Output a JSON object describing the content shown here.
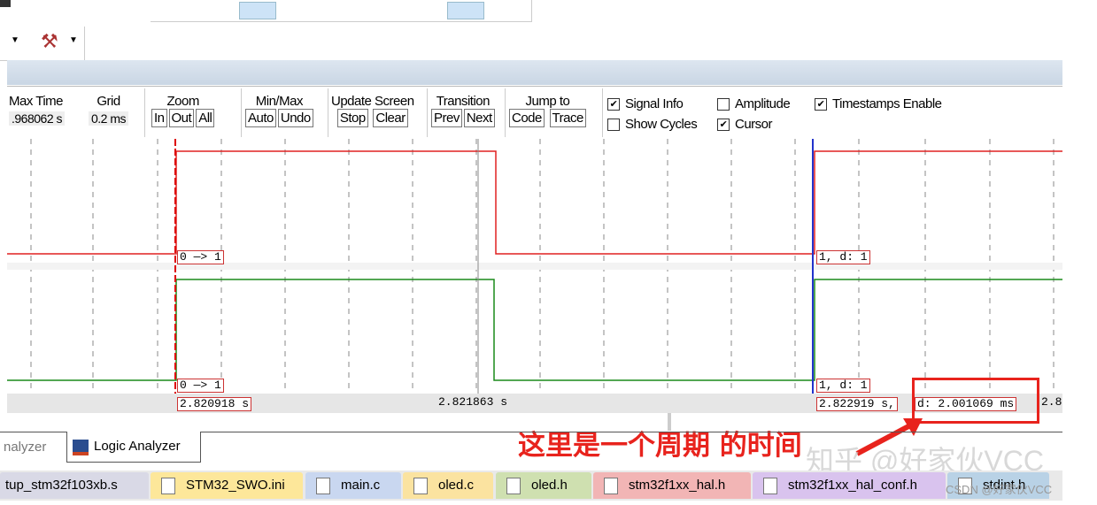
{
  "controls": {
    "max_time": {
      "label": "Max Time",
      "value": ".968062 s"
    },
    "grid": {
      "label": "Grid",
      "value": "0.2 ms"
    },
    "zoom": {
      "label": "Zoom",
      "in": "In",
      "out": "Out",
      "all": "All"
    },
    "minmax": {
      "label": "Min/Max",
      "auto": "Auto",
      "undo": "Undo"
    },
    "update": {
      "label": "Update Screen",
      "stop": "Stop",
      "clear": "Clear"
    },
    "transition": {
      "label": "Transition",
      "prev": "Prev",
      "next": "Next"
    },
    "jump": {
      "label": "Jump to",
      "code": "Code",
      "trace": "Trace"
    },
    "options": {
      "signal_info": "Signal Info",
      "show_cycles": "Show Cycles",
      "amplitude": "Amplitude",
      "cursor": "Cursor",
      "timestamps": "Timestamps Enable"
    }
  },
  "waveform": {
    "sig1_label_left": "0 —> 1",
    "sig1_label_right": "1,  d: 1",
    "sig2_label_left": "0 —> 1",
    "sig2_label_right": "1,  d: 1",
    "colors": {
      "sig1": "#e02020",
      "sig2": "#1a8a1a"
    }
  },
  "axis": {
    "t1": "2.820918 s",
    "t2": "2.821863 s",
    "t3": "2.822919 s,",
    "delta": "d: 2.001069 ms",
    "t4": "2.8"
  },
  "annotation": {
    "text": "这里是一个周期 的时间",
    "color": "#e8231d"
  },
  "panel_tabs": [
    "nalyzer",
    "Logic Analyzer"
  ],
  "file_tabs": [
    {
      "name": "tup_stm32f103xb.s",
      "color": "#d9d9e6"
    },
    {
      "name": "STM32_SWO.ini",
      "color": "#fde79a"
    },
    {
      "name": "main.c",
      "color": "#c9d7f0"
    },
    {
      "name": "oled.c",
      "color": "#fbe3a0"
    },
    {
      "name": "oled.h",
      "color": "#cfe0b0"
    },
    {
      "name": "stm32f1xx_hal.h",
      "color": "#f2b5b5"
    },
    {
      "name": "stm32f1xx_hal_conf.h",
      "color": "#d9c3ee"
    },
    {
      "name": "stdint.h",
      "color": "#b9d2e6"
    }
  ],
  "watermark": {
    "zhihu": "知乎 @好家伙VCC",
    "csdn": "CSDN @好家伙VCC"
  }
}
